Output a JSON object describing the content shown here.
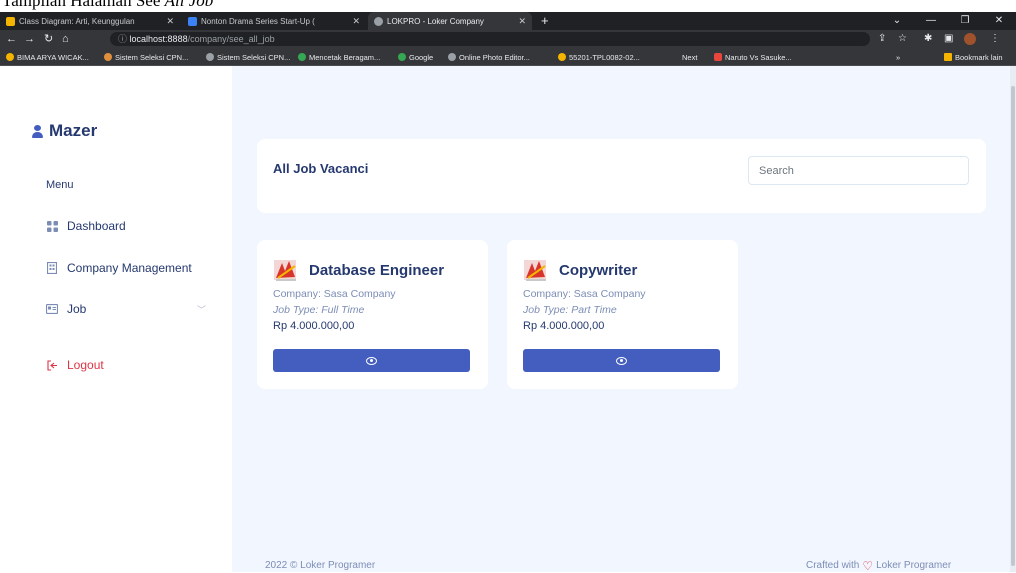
{
  "caption": {
    "prefix": "Tampilan Halaman See ",
    "italic": "All Job"
  },
  "browser": {
    "tabs": [
      {
        "label": "Class Diagram: Arti, Keunggulan",
        "color": "#f4b400"
      },
      {
        "label": "Nonton Drama Series Start-Up (",
        "color": "#3b82f6"
      },
      {
        "label": "LOKPRO - Loker Company",
        "color": "#9aa0a6"
      }
    ],
    "new_tab": "+",
    "url_host": "localhost:8888",
    "url_path": "/company/see_all_job",
    "bookmarks": [
      {
        "label": "BIMA ARYA WICAK...",
        "color": "#f4b400"
      },
      {
        "label": "Sistem Seleksi CPN...",
        "color": "#e0903c"
      },
      {
        "label": "Sistem Seleksi CPN...",
        "color": "#9aa0a6"
      },
      {
        "label": "Mencetak Beragam...",
        "color": "#34a853"
      },
      {
        "label": "Google",
        "color": "#34a853"
      },
      {
        "label": "Online Photo Editor...",
        "color": "#9aa0a6"
      },
      {
        "label": "55201-TPL0082-02...",
        "color": "#f4b400"
      },
      {
        "label": "Next",
        "color": ""
      },
      {
        "label": "Naruto Vs Sasuke...",
        "color": "#e8453c"
      },
      {
        "label": "Bookmark lain",
        "color": "#f4b400"
      }
    ]
  },
  "sidebar": {
    "brand": "Mazer",
    "menu_title": "Menu",
    "items": [
      {
        "label": "Dashboard",
        "icon": "grid-icon"
      },
      {
        "label": "Company Management",
        "icon": "building-icon"
      },
      {
        "label": "Job",
        "icon": "card-icon"
      },
      {
        "label": "Logout",
        "icon": "logout-icon"
      }
    ]
  },
  "main": {
    "title": "All Job Vacanci",
    "search_placeholder": "Search",
    "jobs": [
      {
        "title": "Database Engineer",
        "company": "Company: Sasa Company",
        "type": "Job Type: Full Time",
        "salary": "Rp 4.000.000,00"
      },
      {
        "title": "Copywriter",
        "company": "Company: Sasa Company",
        "type": "Job Type: Part Time",
        "salary": "Rp 4.000.000,00"
      }
    ]
  },
  "footer": {
    "left": "2022 © Loker Programer",
    "right_prefix": "Crafted with",
    "right_suffix": "Loker Programer"
  },
  "colors": {
    "primary": "#435ebe",
    "heading": "#25396f",
    "muted": "#7c8db5",
    "danger": "#dc3545",
    "background": "#f2f7ff"
  }
}
